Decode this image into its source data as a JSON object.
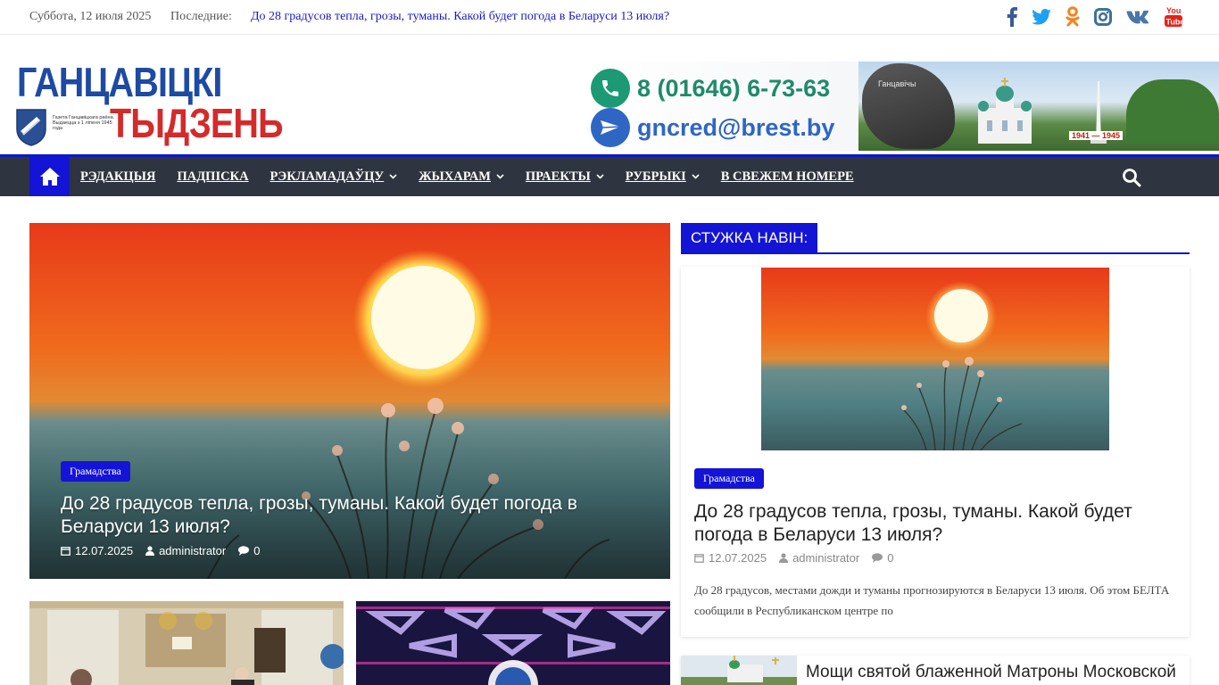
{
  "topbar": {
    "date": "Суббота, 12 июля 2025",
    "latest_label": "Последние:",
    "latest_link": "До 28 градусов тепла, грозы, туманы. Какой будет погода в Беларуси 13 июля?",
    "social": [
      {
        "icon": "facebook-icon",
        "color": "#3b5998"
      },
      {
        "icon": "twitter-icon",
        "color": "#1da1f2"
      },
      {
        "icon": "odnoklassniki-icon",
        "color": "#f58220"
      },
      {
        "icon": "instagram-icon",
        "color": "#3f729b"
      },
      {
        "icon": "vk-icon",
        "color": "#4a76a8"
      },
      {
        "icon": "youtube-icon",
        "color": "#e62117"
      }
    ]
  },
  "logo": {
    "line1": "ГАНЦАВІЦКІ",
    "line2": "ТЫДЗЕНЬ",
    "tagline": "Газета Ганцавіцкага раёна. Выдаецца з 1 ліпеня 1945 года"
  },
  "banner": {
    "phone": "8 (01646) 6-73-63",
    "email": "gncred@brest.by",
    "stone_text": "Ганцавічы",
    "dates": "1941 — 1945"
  },
  "nav": {
    "home_icon": "home-icon",
    "items": [
      {
        "label": "РЭДАКЦЫЯ",
        "dropdown": false
      },
      {
        "label": "ПАДПІСКА",
        "dropdown": false
      },
      {
        "label": "РЭКЛАМАДАЎЦУ",
        "dropdown": true
      },
      {
        "label": "ЖЫХАРАМ",
        "dropdown": true
      },
      {
        "label": "ПРАЕКТЫ",
        "dropdown": true
      },
      {
        "label": "РУБРЫКІ",
        "dropdown": true
      },
      {
        "label": "В СВЕЖЕМ НОМЕРЕ",
        "dropdown": false
      }
    ]
  },
  "hero": {
    "category": "Грамадства",
    "title": "До 28 градусов тепла, грозы, туманы. Какой будет погода в Беларуси 13 июля?",
    "date": "12.07.2025",
    "author": "administrator",
    "comments": "0"
  },
  "sidebar": {
    "heading": "СТУЖКА НАВІН:",
    "card": {
      "category": "Грамадства",
      "title": "До 28 градусов тепла, грозы, туманы. Какой будет погода в Беларуси 13 июля?",
      "date": "12.07.2025",
      "author": "administrator",
      "comments": "0",
      "excerpt": "До 28 градусов, местами дожди и туманы прогнозируются в Беларуси 13 июля. Об этом БЕЛТА сообщили в Республиканском центре по"
    },
    "next_item_title": "Мощи святой блаженной Матроны Московской"
  },
  "colors": {
    "accent": "#1414d6",
    "nav_bg": "#2f3540",
    "link": "#1a1ac8"
  }
}
